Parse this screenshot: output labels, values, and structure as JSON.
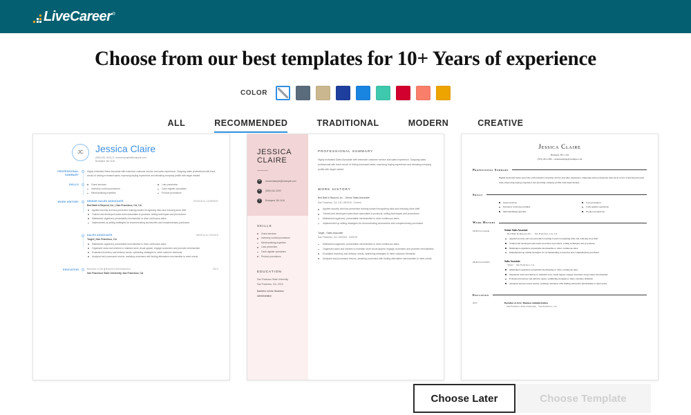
{
  "header": {
    "brand": "LiveCareer",
    "trademark": "®",
    "bg_color": "#046070"
  },
  "page_title": "Choose from our best templates for 10+ Years of experience",
  "color_picker": {
    "label": "COLOR",
    "selected_index": 0,
    "swatches": [
      {
        "name": "none",
        "hex": "#ffffff",
        "selected": true
      },
      {
        "name": "slate-gray",
        "hex": "#5a6b7b",
        "selected": false
      },
      {
        "name": "khaki-tan",
        "hex": "#cbb78f",
        "selected": false
      },
      {
        "name": "navy-blue",
        "hex": "#1f3f9e",
        "selected": false
      },
      {
        "name": "bright-blue",
        "hex": "#1a85e0",
        "selected": false
      },
      {
        "name": "turquoise",
        "hex": "#3ec8ae",
        "selected": false
      },
      {
        "name": "crimson-red",
        "hex": "#d2002e",
        "selected": false
      },
      {
        "name": "salmon-coral",
        "hex": "#f97f6b",
        "selected": false
      },
      {
        "name": "amber-gold",
        "hex": "#eda400",
        "selected": false
      }
    ]
  },
  "tabs": [
    {
      "label": "ALL",
      "active": false
    },
    {
      "label": "RECOMMENDED",
      "active": true
    },
    {
      "label": "TRADITIONAL",
      "active": false
    },
    {
      "label": "MODERN",
      "active": false
    },
    {
      "label": "CREATIVE",
      "active": false
    }
  ],
  "resume": {
    "name": "Jessica Claire",
    "monogram": "JC",
    "name_upper_line1": "JESSICA",
    "name_upper_line2": "CLAIRE",
    "phone": "(555) 432-1000",
    "email": "resumesample@example.com",
    "location": "Budapest, BU 1116",
    "contact_inline": "(555) 432-1000 | E: resumesample@example.com",
    "contact_inline_t3": "(555) 432-1000 - resumesample@example.com",
    "summary": "Highly motivated Sales Associate with extensive customer service and sales experience. Outgoing sales professional with track record of driving increased sales, improving buying experience and elevating company profile with target market.",
    "skills_left": [
      "Guest services",
      "Inventory control procedures",
      "Merchandising expertise"
    ],
    "skills_right": [
      "Loss prevention",
      "Cash register operations",
      "Product promotions"
    ],
    "skills_all": [
      "Guest services",
      "Inventory control procedures",
      "Merchandising expertise",
      "Loss prevention",
      "Cash register operations",
      "Product promotions"
    ],
    "jobs": [
      {
        "role": "SENIOR SALES ASSOCIATE",
        "role_title": "Senior Sales Associate",
        "employer": "Bed Bath & Beyond, Inc.",
        "employer_line": "Bed Bath & Beyond, Inc. | San Francisco, CA, CA",
        "employer_line_t2": "Bed Bath & Beyond, Inc. - Senior Sales Associate",
        "meta_t2": "San Francisco, CA, CA • 03/2018 - Current",
        "location": "San Francisco, CA, CA",
        "date": "03/2018 to CURRENT",
        "date_t3": "03/2015 to Current",
        "bullets": [
          "Applied security and loss prevention training toward recognizing risks and reducing store theft",
          "Trained and developed sales team associates in products, selling techniques and procedures",
          "Maintained organized, presentable merchandise to drive continuous sales",
          "Implemented up-selling strategies for recommending accessories and complementary purchases"
        ]
      },
      {
        "role": "SALES ASSOCIATE",
        "role_title": "Sales Associate",
        "employer": "Target",
        "employer_line": "Target | San Francisco, CA",
        "employer_line_t2": "Target - Sales Associate",
        "meta_t2": "San Francisco, CA • 06/2013 - 03/2015",
        "location": "San Francisco, CA",
        "date": "08/2013 to 03/2018",
        "date_t3": "06/2013 to 03/2015",
        "bullets": [
          "Maintained organized, presentable merchandise to drive continuous sales",
          "Organized racks and shelves to maintain store visual appeal, engage customers and promote merchandise",
          "Evaluated inventory and delivery needs, optimizing strategies to meet customer demands",
          "Analyzed and processed returns, assisting customers with finding alternative merchandise to meet needs"
        ]
      }
    ],
    "education": {
      "degree": "Bachelor of Arts",
      "field": "Business Administration",
      "degree_full": "Bachelor of Arts: Business Administration",
      "school": "San Francisco State University",
      "school_line": "San Francisco State University, San Francisco, CA",
      "school_location": "San Francisco, CA",
      "date": "2013",
      "date_line_t2": "San Francisco, CA • 2013",
      "degree_t2_line1": "Bachelor of Arts: Business",
      "degree_t2_line2": "Administration"
    },
    "sections": {
      "summary_label": "PROFESSIONAL SUMMARY",
      "summary_label_words": [
        "PROFESSIONAL",
        "SUMMARY"
      ],
      "skills_label": "SKILLS",
      "work_label": "WORK HISTORY",
      "education_label": "EDUCATION",
      "summary_title_t3": "Professional Summary",
      "skills_title_t3": "Skills",
      "work_title_t3": "Work History",
      "education_title_t3": "Education"
    }
  },
  "footer": {
    "choose_later": "Choose Later",
    "choose_template": "Choose Template",
    "choose_template_disabled": true
  }
}
